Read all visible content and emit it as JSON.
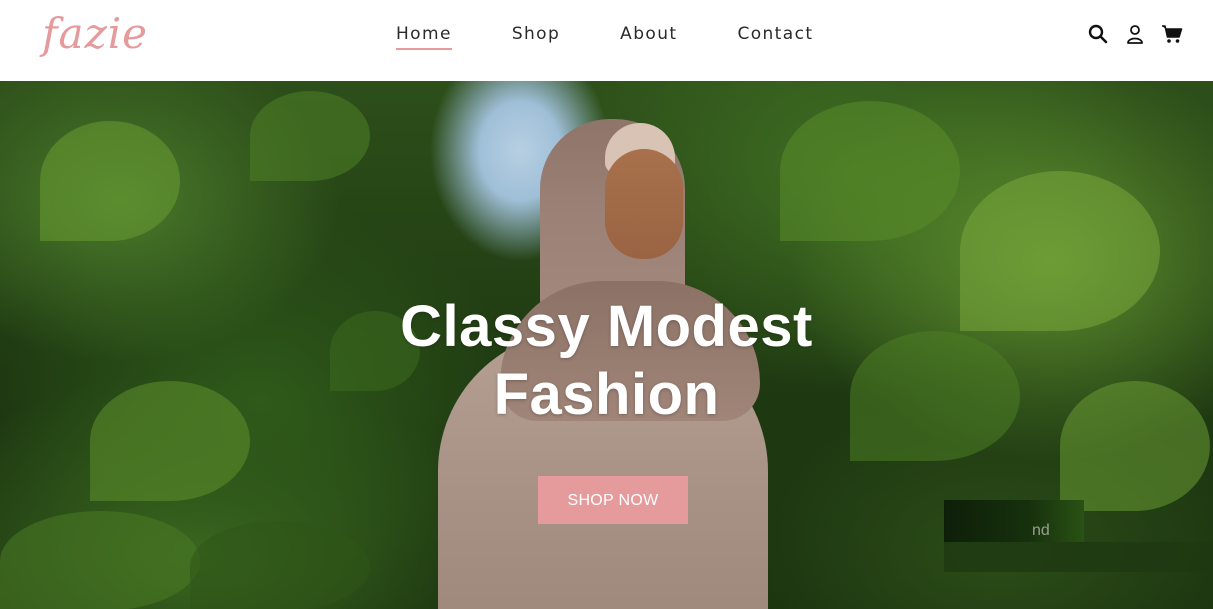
{
  "header": {
    "logo_text": "fazie",
    "nav": [
      {
        "label": "Home",
        "active": true
      },
      {
        "label": "Shop",
        "active": false
      },
      {
        "label": "About",
        "active": false
      },
      {
        "label": "Contact",
        "active": false
      }
    ],
    "icons": [
      "search-icon",
      "user-icon",
      "cart-icon"
    ]
  },
  "hero": {
    "title_line1": "Classy Modest",
    "title_line2": "Fashion",
    "cta_label": "SHOP NOW",
    "overlay_fragment": "nd"
  },
  "colors": {
    "accent": "#e59a9b",
    "nav_text": "#2a2a2a",
    "hero_text": "#ffffff"
  }
}
